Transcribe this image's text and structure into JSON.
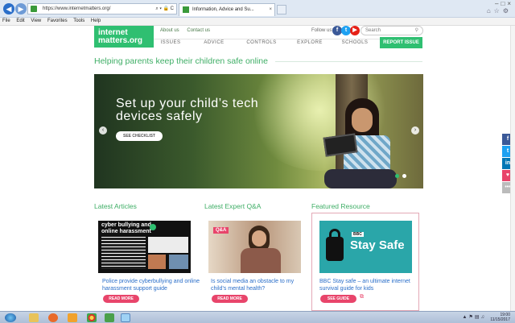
{
  "browser": {
    "url": "https://www.internetmatters.org/",
    "tab_title": "Information, Advice and Su...",
    "address_tools": "⌕ ▾ 🔒 C",
    "menu": [
      "File",
      "Edit",
      "View",
      "Favorites",
      "Tools",
      "Help"
    ]
  },
  "header": {
    "logo_line1": "internet",
    "logo_line2": "matters.org",
    "top_links": [
      "About us",
      "Contact us"
    ],
    "follow_label": "Follow us:",
    "search_placeholder": "Search",
    "nav": [
      "ISSUES",
      "ADVICE",
      "CONTROLS",
      "EXPLORE",
      "SCHOOLS"
    ],
    "report_label": "REPORT ISSUE"
  },
  "tagline": "Helping parents keep their children safe online",
  "hero": {
    "title_line1": "Set up your child’s tech",
    "title_line2": "devices safely",
    "button": "SEE CHECKLIST"
  },
  "share_buttons": [
    "f",
    "t",
    "in",
    "♥",
    "•••"
  ],
  "sections": {
    "articles": {
      "title": "Latest Articles",
      "image_heading_line1": "cyber bullying and",
      "image_heading_line2": "online harassment",
      "card_title": "Police provide cyberbullying and online harassment support guide",
      "button": "READ MORE"
    },
    "qa": {
      "title": "Latest Expert Q&A",
      "badge": "Q&A",
      "card_title": "Is social media an obstacle to my child’s mental health?",
      "button": "READ MORE"
    },
    "featured": {
      "title": "Featured Resource",
      "image_brand": "BBC",
      "image_text": "Stay Safe",
      "card_title": "BBC Stay safe – an ultimate internet survival guide for kids",
      "button": "SEE GUIDE"
    }
  },
  "taskbar": {
    "time": "19:00",
    "date": "11/15/2017"
  },
  "colors": {
    "brand_green": "#2fbf71",
    "button_pink": "#e8456b",
    "link_blue": "#2a6ec9"
  }
}
